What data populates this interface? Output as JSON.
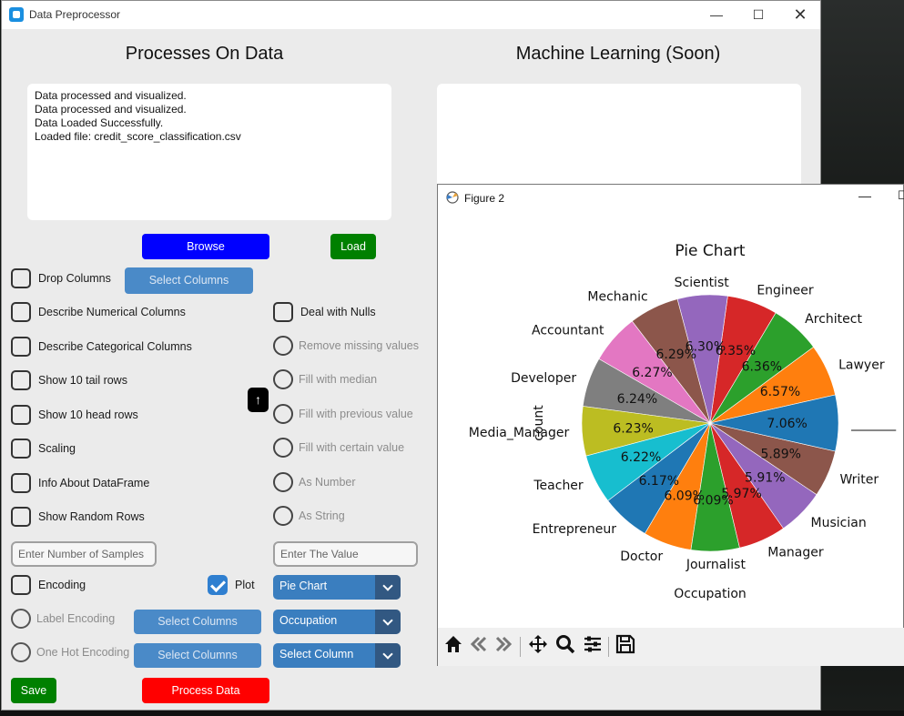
{
  "window": {
    "title": "Data Preprocessor"
  },
  "headings": {
    "left": "Processes On Data",
    "right": "Machine Learning (Soon)"
  },
  "log_lines": [
    "Data processed and visualized.",
    "Data processed and visualized.",
    "Data Loaded Successfully.",
    "Loaded file: credit_score_classification.csv"
  ],
  "buttons": {
    "browse": "Browse",
    "load": "Load",
    "save": "Save",
    "process": "Process Data",
    "select_columns": "Select Columns",
    "arrow": "↑"
  },
  "checkboxes": {
    "drop_columns": "Drop Columns",
    "describe_numerical": "Describe Numerical Columns",
    "describe_categorical": "Describe Categorical Columns",
    "tail_rows": "Show 10 tail rows",
    "head_rows": "Show 10 head rows",
    "scaling": "Scaling",
    "info": "Info About DataFrame",
    "random_rows": "Show Random Rows",
    "deal_nulls": "Deal with Nulls",
    "encoding": "Encoding",
    "plot": "Plot"
  },
  "radios": {
    "remove_missing": "Remove missing values",
    "fill_median": "Fill with median",
    "fill_previous": "Fill with previous value",
    "fill_certain": "Fill with certain value",
    "as_number": "As Number",
    "as_string": "As String",
    "label_encoding": "Label Encoding",
    "one_hot": "One Hot Encoding"
  },
  "inputs": {
    "samples_placeholder": "Enter Number of Samples",
    "value_placeholder": "Enter The Value"
  },
  "combos": {
    "plot_type": "Pie Chart",
    "column": "Occupation",
    "select_column": "Select Column"
  },
  "figure": {
    "title": "Figure 2",
    "toolbar": [
      "home-icon",
      "back-icon",
      "forward-icon",
      "pan-icon",
      "zoom-icon",
      "configure-icon",
      "save-icon"
    ]
  },
  "colors": {
    "browse": "#0000ff",
    "load": "#008000",
    "save": "#008000",
    "process": "#ff0000",
    "accent": "#3a7ebf"
  },
  "chart_data": {
    "type": "pie",
    "title": "Pie Chart",
    "xlabel": "Occupation",
    "ylabel": "count",
    "categories": [
      "Lawyer",
      "Architect",
      "Engineer",
      "Scientist",
      "Mechanic",
      "Accountant",
      "Developer",
      "Media_Manager",
      "Teacher",
      "Entrepreneur",
      "Doctor",
      "Journalist",
      "Manager",
      "Musician",
      "Writer",
      "_______"
    ],
    "values": [
      6.57,
      6.36,
      6.35,
      6.3,
      6.29,
      6.27,
      6.24,
      6.23,
      6.22,
      6.17,
      6.09,
      6.09,
      5.97,
      5.91,
      5.89,
      7.06
    ],
    "labels": [
      "6.57%",
      "6.36%",
      "6.35%",
      "6.30%",
      "6.29%",
      "6.27%",
      "6.24%",
      "6.23%",
      "6.22%",
      "6.17%",
      "6.09%",
      "6.09%",
      "5.97%",
      "5.91%",
      "5.89%",
      "7.06%"
    ],
    "colors": [
      "#ff7f0e",
      "#2ca02c",
      "#d62728",
      "#9467bd",
      "#8c564b",
      "#e377c2",
      "#7f7f7f",
      "#bcbd22",
      "#17becf",
      "#1f77b4",
      "#ff7f0e",
      "#2ca02c",
      "#d62728",
      "#9467bd",
      "#8c564b",
      "#1f77b4"
    ]
  }
}
